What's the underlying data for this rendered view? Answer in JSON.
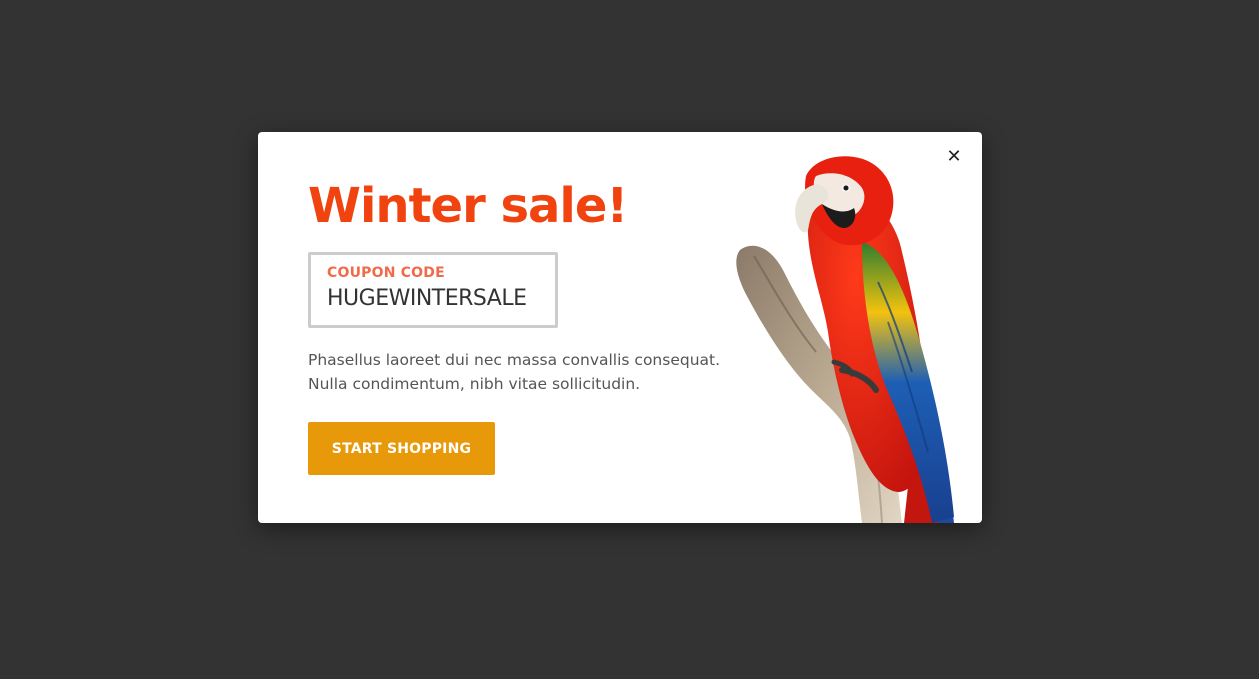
{
  "modal": {
    "close_icon": "close-icon",
    "close_glyph": "✕",
    "title": "Winter sale!",
    "coupon": {
      "label": "COUPON CODE",
      "code": "HUGEWINTERSALE"
    },
    "description_line1": "Phasellus laoreet dui nec massa convallis consequat.",
    "description_line2": "Nulla condimentum, nibh vitae sollicitudin.",
    "cta_label": "START SHOPPING",
    "image_icon": "parrot-image"
  },
  "colors": {
    "backdrop": "#333333",
    "title": "#f0430f",
    "coupon_label": "#ef6b4a",
    "cta_background": "#e8990a"
  }
}
